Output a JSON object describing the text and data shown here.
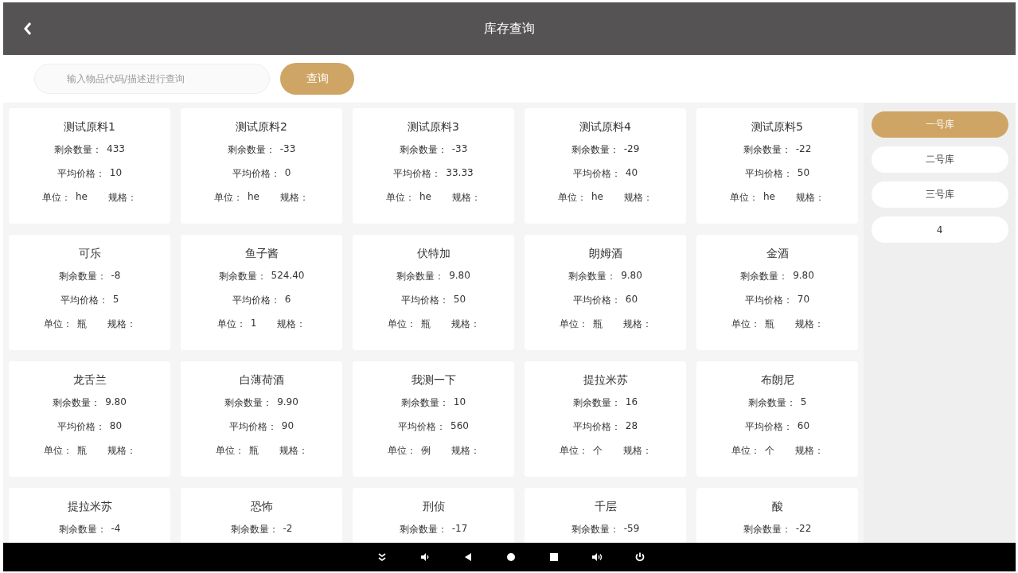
{
  "header": {
    "title": "库存查询"
  },
  "search": {
    "placeholder": "输入物品代码/描述进行查询",
    "button": "查询"
  },
  "items": [
    {
      "name": "测试原料1",
      "lines": [
        {
          "pairs": [
            {
              "label": "剩余数量：",
              "value": "433"
            }
          ]
        },
        {
          "pairs": [
            {
              "label": "平均价格：",
              "value": "10"
            }
          ]
        },
        {
          "pairs": [
            {
              "label": "单位：",
              "value": "he"
            },
            {
              "label": "规格："
            }
          ]
        }
      ]
    },
    {
      "name": "测试原料2",
      "lines": [
        {
          "pairs": [
            {
              "label": "剩余数量：",
              "value": "-33"
            }
          ]
        },
        {
          "pairs": [
            {
              "label": "平均价格：",
              "value": "0"
            }
          ]
        },
        {
          "pairs": [
            {
              "label": "单位：",
              "value": "he"
            },
            {
              "label": "规格："
            }
          ]
        }
      ]
    },
    {
      "name": "测试原料3",
      "lines": [
        {
          "pairs": [
            {
              "label": "剩余数量：",
              "value": "-33"
            }
          ]
        },
        {
          "pairs": [
            {
              "label": "平均价格：",
              "value": "33.33"
            }
          ]
        },
        {
          "pairs": [
            {
              "label": "单位：",
              "value": "he"
            },
            {
              "label": "规格："
            }
          ]
        }
      ]
    },
    {
      "name": "测试原料4",
      "lines": [
        {
          "pairs": [
            {
              "label": "剩余数量：",
              "value": "-29"
            }
          ]
        },
        {
          "pairs": [
            {
              "label": "平均价格：",
              "value": "40"
            }
          ]
        },
        {
          "pairs": [
            {
              "label": "单位：",
              "value": "he"
            },
            {
              "label": "规格："
            }
          ]
        }
      ]
    },
    {
      "name": "测试原料5",
      "lines": [
        {
          "pairs": [
            {
              "label": "剩余数量：",
              "value": "-22"
            }
          ]
        },
        {
          "pairs": [
            {
              "label": "平均价格：",
              "value": "50"
            }
          ]
        },
        {
          "pairs": [
            {
              "label": "单位：",
              "value": "he"
            },
            {
              "label": "规格："
            }
          ]
        }
      ]
    },
    {
      "name": "可乐",
      "lines": [
        {
          "pairs": [
            {
              "label": "剩余数量：",
              "value": "-8"
            }
          ]
        },
        {
          "pairs": [
            {
              "label": "平均价格：",
              "value": "5"
            }
          ]
        },
        {
          "pairs": [
            {
              "label": "单位：",
              "value": "瓶"
            },
            {
              "label": "规格："
            }
          ]
        }
      ]
    },
    {
      "name": "鱼子酱",
      "lines": [
        {
          "pairs": [
            {
              "label": "剩余数量：",
              "value": "524.40"
            }
          ]
        },
        {
          "pairs": [
            {
              "label": "平均价格：",
              "value": "6"
            }
          ]
        },
        {
          "pairs": [
            {
              "label": "单位：",
              "value": "1"
            },
            {
              "label": "规格："
            }
          ]
        }
      ]
    },
    {
      "name": "伏特加",
      "lines": [
        {
          "pairs": [
            {
              "label": "剩余数量：",
              "value": "9.80"
            }
          ]
        },
        {
          "pairs": [
            {
              "label": "平均价格：",
              "value": "50"
            }
          ]
        },
        {
          "pairs": [
            {
              "label": "单位：",
              "value": "瓶"
            },
            {
              "label": "规格："
            }
          ]
        }
      ]
    },
    {
      "name": "朗姆酒",
      "lines": [
        {
          "pairs": [
            {
              "label": "剩余数量：",
              "value": "9.80"
            }
          ]
        },
        {
          "pairs": [
            {
              "label": "平均价格：",
              "value": "60"
            }
          ]
        },
        {
          "pairs": [
            {
              "label": "单位：",
              "value": "瓶"
            },
            {
              "label": "规格："
            }
          ]
        }
      ]
    },
    {
      "name": "金酒",
      "lines": [
        {
          "pairs": [
            {
              "label": "剩余数量：",
              "value": "9.80"
            }
          ]
        },
        {
          "pairs": [
            {
              "label": "平均价格：",
              "value": "70"
            }
          ]
        },
        {
          "pairs": [
            {
              "label": "单位：",
              "value": "瓶"
            },
            {
              "label": "规格："
            }
          ]
        }
      ]
    },
    {
      "name": "龙舌兰",
      "lines": [
        {
          "pairs": [
            {
              "label": "剩余数量：",
              "value": "9.80"
            }
          ]
        },
        {
          "pairs": [
            {
              "label": "平均价格：",
              "value": "80"
            }
          ]
        },
        {
          "pairs": [
            {
              "label": "单位：",
              "value": "瓶"
            },
            {
              "label": "规格："
            }
          ]
        }
      ]
    },
    {
      "name": "白薄荷酒",
      "lines": [
        {
          "pairs": [
            {
              "label": "剩余数量：",
              "value": "9.90"
            }
          ]
        },
        {
          "pairs": [
            {
              "label": "平均价格：",
              "value": "90"
            }
          ]
        },
        {
          "pairs": [
            {
              "label": "单位：",
              "value": "瓶"
            },
            {
              "label": "规格："
            }
          ]
        }
      ]
    },
    {
      "name": "我测一下",
      "lines": [
        {
          "pairs": [
            {
              "label": "剩余数量：",
              "value": "10"
            }
          ]
        },
        {
          "pairs": [
            {
              "label": "平均价格：",
              "value": "560"
            }
          ]
        },
        {
          "pairs": [
            {
              "label": "单位：",
              "value": "例"
            },
            {
              "label": "规格："
            }
          ]
        }
      ]
    },
    {
      "name": "提拉米苏",
      "lines": [
        {
          "pairs": [
            {
              "label": "剩余数量：",
              "value": "16"
            }
          ]
        },
        {
          "pairs": [
            {
              "label": "平均价格：",
              "value": "28"
            }
          ]
        },
        {
          "pairs": [
            {
              "label": "单位：",
              "value": "个"
            },
            {
              "label": "规格："
            }
          ]
        }
      ]
    },
    {
      "name": "布朗尼",
      "lines": [
        {
          "pairs": [
            {
              "label": "剩余数量：",
              "value": "5"
            }
          ]
        },
        {
          "pairs": [
            {
              "label": "平均价格：",
              "value": "60"
            }
          ]
        },
        {
          "pairs": [
            {
              "label": "单位：",
              "value": "个"
            },
            {
              "label": "规格："
            }
          ]
        }
      ]
    },
    {
      "name": "提拉米苏",
      "lines": [
        {
          "pairs": [
            {
              "label": "剩余数量：",
              "value": "-4"
            }
          ]
        }
      ]
    },
    {
      "name": "恐怖",
      "lines": [
        {
          "pairs": [
            {
              "label": "剩余数量：",
              "value": "-2"
            }
          ]
        }
      ]
    },
    {
      "name": "刑侦",
      "lines": [
        {
          "pairs": [
            {
              "label": "剩余数量：",
              "value": "-17"
            }
          ]
        }
      ]
    },
    {
      "name": "千层",
      "lines": [
        {
          "pairs": [
            {
              "label": "剩余数量：",
              "value": "-59"
            }
          ]
        }
      ]
    },
    {
      "name": "酸",
      "lines": [
        {
          "pairs": [
            {
              "label": "剩余数量：",
              "value": "-22"
            }
          ]
        }
      ]
    }
  ],
  "warehouses": [
    {
      "label": "一号库",
      "selected": true
    },
    {
      "label": "二号库",
      "selected": false
    },
    {
      "label": "三号库",
      "selected": false
    },
    {
      "label": "4",
      "selected": false
    }
  ]
}
